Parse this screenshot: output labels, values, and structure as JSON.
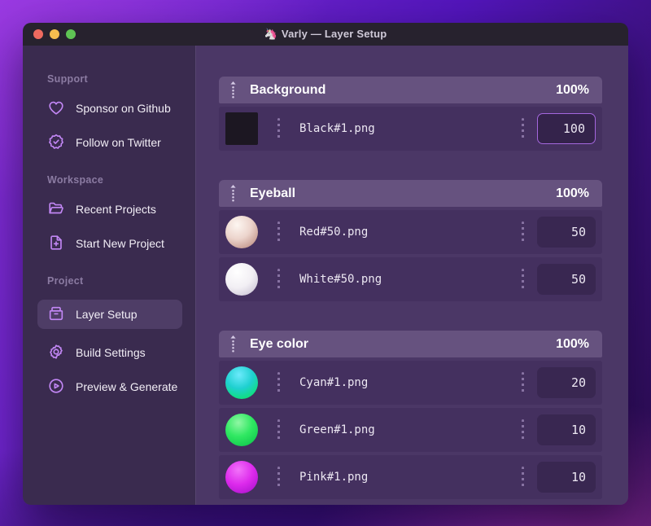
{
  "window": {
    "app_icon": "🦄",
    "title": "Varly — Layer Setup",
    "traffic_lights": [
      "close",
      "minimize",
      "zoom"
    ]
  },
  "sidebar": {
    "sections": [
      {
        "label": "Support",
        "items": [
          {
            "label": "Sponsor on Github",
            "icon": "heart-icon"
          },
          {
            "label": "Follow on Twitter",
            "icon": "badge-check-icon"
          }
        ]
      },
      {
        "label": "Workspace",
        "items": [
          {
            "label": "Recent Projects",
            "icon": "folder-icon"
          },
          {
            "label": "Start New Project",
            "icon": "file-plus-icon"
          }
        ]
      },
      {
        "label": "Project",
        "items": [
          {
            "label": "Layer Setup",
            "icon": "archive-icon",
            "active": true
          },
          {
            "label": "Build Settings",
            "icon": "gear-icon"
          },
          {
            "label": "Preview & Generate",
            "icon": "play-circle-icon"
          }
        ]
      }
    ]
  },
  "main": {
    "groups": [
      {
        "name": "Background",
        "weight": "100%",
        "layers": [
          {
            "file": "Black#1.png",
            "value": "100",
            "thumb": "black-square",
            "focused": true
          }
        ]
      },
      {
        "name": "Eyeball",
        "weight": "100%",
        "layers": [
          {
            "file": "Red#50.png",
            "value": "50",
            "thumb": "red-sphere",
            "focused": false
          },
          {
            "file": "White#50.png",
            "value": "50",
            "thumb": "white-sphere",
            "focused": false
          }
        ]
      },
      {
        "name": "Eye color",
        "weight": "100%",
        "layers": [
          {
            "file": "Cyan#1.png",
            "value": "20",
            "thumb": "cyan-sphere",
            "focused": false
          },
          {
            "file": "Green#1.png",
            "value": "10",
            "thumb": "green-sphere",
            "focused": false
          },
          {
            "file": "Pink#1.png",
            "value": "10",
            "thumb": "pink-sphere",
            "focused": false
          }
        ]
      }
    ]
  },
  "colors": {
    "accent_purple": "#c287f5",
    "focus_border": "#a467de",
    "group_header_bg": "#66527f",
    "row_bg": "#44305f",
    "main_bg": "#4b3766",
    "sidebar_bg": "#3a2b4f",
    "titlebar_bg": "#27222e",
    "traffic_red": "#ee6a5f",
    "traffic_yellow": "#f5bd4f",
    "traffic_green": "#5fc454"
  }
}
